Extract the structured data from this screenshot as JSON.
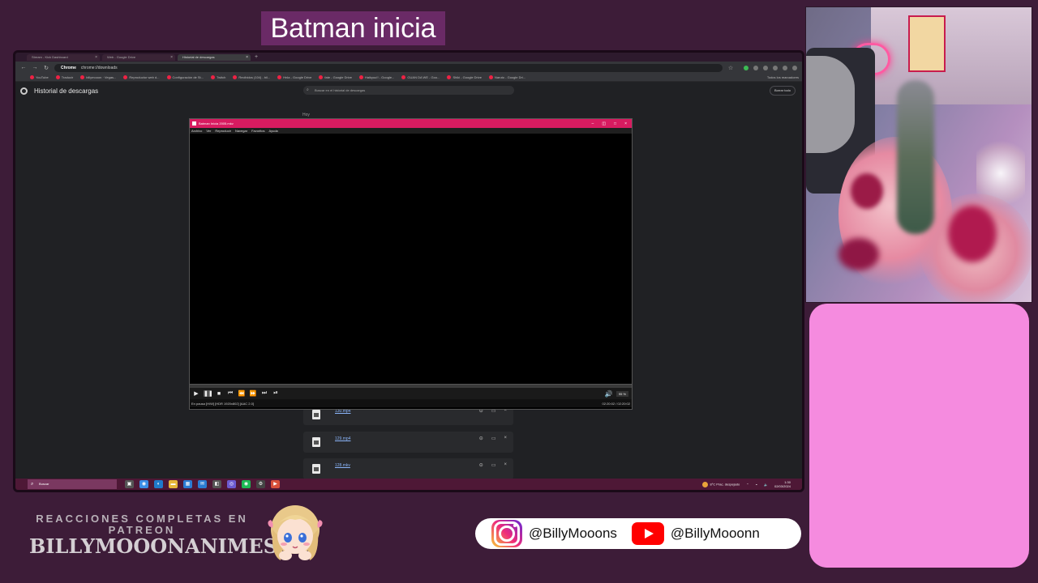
{
  "overlay": {
    "title": "Batman inicia",
    "patreon_line": "REACCIONES COMPLETAS EN PATREON",
    "patreon_name": "BILLYMOOONANIMES",
    "instagram_handle": "@BillyMooons",
    "youtube_handle": "@BillyMooonn"
  },
  "browser": {
    "tabs": [
      {
        "label": "Stream - Kick Dashboard"
      },
      {
        "label": "Web - Google Drive"
      },
      {
        "label": "Historial de descargas"
      }
    ],
    "url_prefix": "Chrome",
    "url": "chrome://downloads",
    "bookmarks": [
      "YouTube",
      "Traducir",
      "billymooon · Vegas...",
      "Reproductor web d...",
      "Configuración de St...",
      "Twitch",
      "Recibidos (104) - bil...",
      "Hnla - Google Drive",
      "fate - Google Drive",
      "Haikyuu!! - Google...",
      "GUAN DA WE - Goo...",
      "Shiki - Google Drive",
      "Naruto - Google Dri..."
    ],
    "bookmarks_right": "Todos los marcadores"
  },
  "downloads": {
    "title": "Historial de descargas",
    "search_placeholder": "Buscar en el historial de descargas",
    "clear_all": "Borrar todo",
    "section": "Hoy",
    "items": [
      {
        "name": "130.mp4"
      },
      {
        "name": "129.mp4"
      },
      {
        "name": "128.mkv"
      }
    ]
  },
  "player": {
    "title": "Batman Inicia 2005.mkv",
    "menu": [
      "Archivo",
      "Ver",
      "Reproducir",
      "Navegar",
      "Favoritos",
      "Ayuda"
    ],
    "volume": "95 %",
    "status_left": "En pausa [H/W]    [HDR 1920x802]    [AAC 2.0]",
    "status_time": "02:20:02 / 02:20:02"
  },
  "taskbar": {
    "search": "Buscar",
    "weather": "8°C  Prac. despejado",
    "time": "1:30",
    "date": "02/03/2024"
  }
}
